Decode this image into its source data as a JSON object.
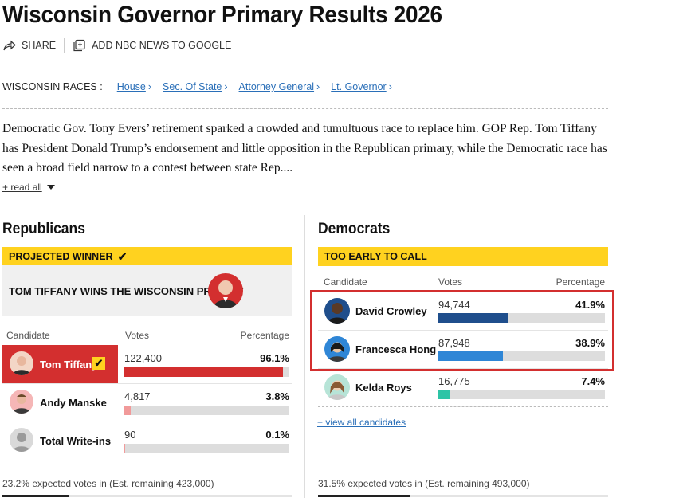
{
  "header": {
    "title": "Wisconsin Governor Primary Results 2026",
    "share_label": "SHARE",
    "google_label": "ADD NBC NEWS TO GOOGLE"
  },
  "races_nav": {
    "label": "WISCONSIN RACES :",
    "links": [
      "House",
      "Sec. Of State",
      "Attorney General",
      "Lt. Governor"
    ]
  },
  "description": {
    "text": "Democratic Gov. Tony Evers’ retirement sparked a crowded and tumultuous race to replace him. GOP Rep. Tom Tiffany has President Donald Trump’s endorsement and little opposition in the Republican primary, while the Democratic race has seen a broad field narrow to a contest between state Rep....",
    "read_all": "+ read all"
  },
  "republicans": {
    "title": "Republicans",
    "status": "PROJECTED WINNER",
    "winner_text": "TOM TIFFANY WINS THE WISCONSIN PRIMARY",
    "col_candidate": "Candidate",
    "col_votes": "Votes",
    "col_pct": "Percentage",
    "candidates": [
      {
        "name": "Tom Tiffany",
        "votes": "122,400",
        "pct": "96.1%",
        "share": 0.961
      },
      {
        "name": "Andy Manske",
        "votes": "4,817",
        "pct": "3.8%",
        "share": 0.038
      },
      {
        "name": "Total Write-ins",
        "votes": "90",
        "pct": "0.1%",
        "share": 0.001
      }
    ],
    "expected": "23.2% expected votes in (Est. remaining 423,000)",
    "expected_share": 0.232
  },
  "democrats": {
    "title": "Democrats",
    "status": "TOO EARLY TO CALL",
    "col_candidate": "Candidate",
    "col_votes": "Votes",
    "col_pct": "Percentage",
    "candidates": [
      {
        "name": "David Crowley",
        "votes": "94,744",
        "pct": "41.9%",
        "share": 0.419
      },
      {
        "name": "Francesca Hong",
        "votes": "87,948",
        "pct": "38.9%",
        "share": 0.389
      },
      {
        "name": "Kelda Roys",
        "votes": "16,775",
        "pct": "7.4%",
        "share": 0.074
      }
    ],
    "view_all": "+ view all candidates",
    "expected": "31.5% expected votes in (Est. remaining 493,000)",
    "expected_share": 0.315
  },
  "colors": {
    "gop_red": "#d32f2f",
    "dem_dark": "#1f4e8c",
    "dem_light": "#2f86d6",
    "dem_teal": "#2ec4a6",
    "gop_pink": "#f19a9a",
    "status_yellow": "#ffd21f"
  }
}
